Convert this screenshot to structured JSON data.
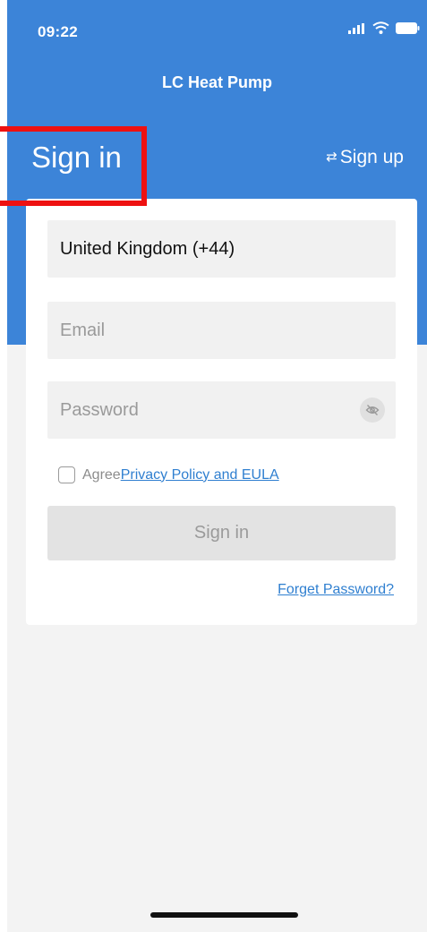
{
  "status_bar": {
    "time": "09:22",
    "icons": [
      "signal-icon",
      "wifi-icon",
      "battery-icon"
    ]
  },
  "header": {
    "app_title": "LC Heat Pump",
    "page_title": "Sign in",
    "signup_label": "Sign up",
    "signup_icon": "swap-arrows-icon"
  },
  "form": {
    "country": "United Kingdom (+44)",
    "email_placeholder": "Email",
    "password_placeholder": "Password",
    "password_toggle_icon": "eye-off-icon",
    "agree_prefix": "Agree",
    "policy_link": "Privacy Policy and EULA",
    "agree_checked": false,
    "signin_button": "Sign in",
    "forget_password": "Forget Password?"
  },
  "colors": {
    "header_blue": "#3c84d8",
    "link_blue": "#2f7fd0",
    "highlight_red": "#ee1111"
  }
}
